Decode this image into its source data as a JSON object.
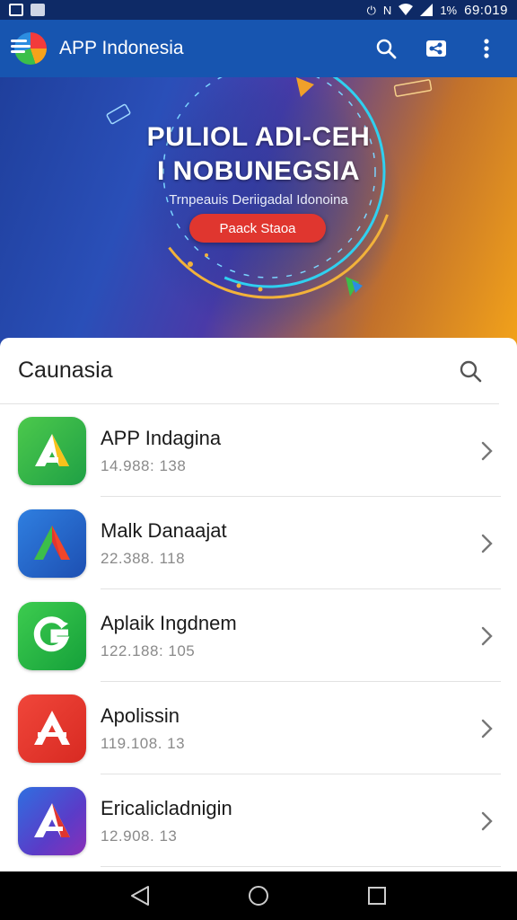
{
  "status_bar": {
    "time": "69:019",
    "battery_text": "1%",
    "icons": [
      "image-icon",
      "notification-icon",
      "nfc-icon",
      "wifi-icon",
      "signal-icon",
      "battery-icon"
    ]
  },
  "app_bar": {
    "title": "APP Indonesia",
    "actions": [
      "search-icon",
      "share-icon",
      "more-vert-icon"
    ]
  },
  "banner": {
    "headline_1": "PULIOL ADI-CEH",
    "headline_2": "I NOBUNEGSIA",
    "subline": "Trnpeauis Deriigadal Idonoina",
    "cta_label": "Paack Staoa"
  },
  "card": {
    "title": "Caunasia",
    "items": [
      {
        "name": "APP Indagina",
        "meta": "14.988: 138",
        "icon": "app-icon-green-a"
      },
      {
        "name": "Malk Danaajat",
        "meta": "22.388. 118",
        "icon": "app-icon-blue-a"
      },
      {
        "name": "Aplaik Ingdnem",
        "meta": "122.188: 105",
        "icon": "app-icon-green-g"
      },
      {
        "name": "Apolissin",
        "meta": "119.108. 13",
        "icon": "app-icon-red-a"
      },
      {
        "name": "Ericalicladnigin",
        "meta": "12.908. 13",
        "icon": "app-icon-gradient-a"
      }
    ]
  },
  "colors": {
    "status_bar": "#0e2a66",
    "app_bar": "#1755b0",
    "cta": "#e0362f",
    "nav_bar": "#000000"
  },
  "nav": [
    "back-icon",
    "home-icon",
    "recents-icon"
  ]
}
